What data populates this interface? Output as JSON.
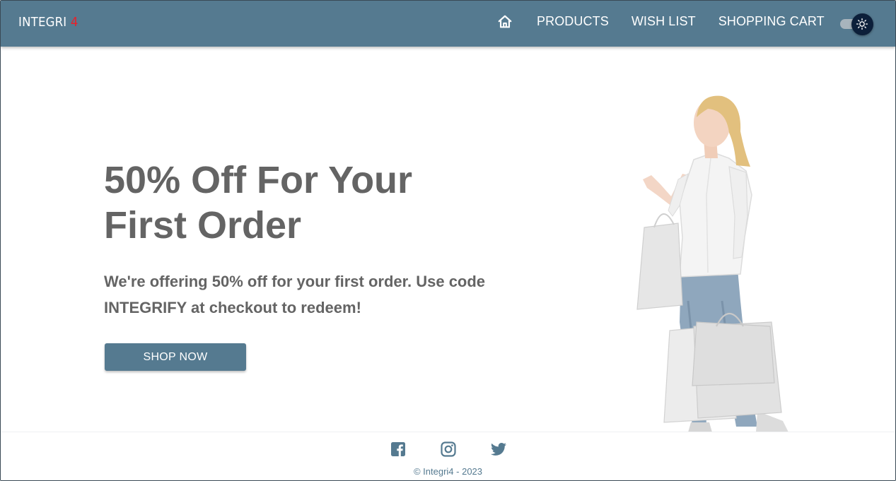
{
  "header": {
    "logo_text": "INTEGRI",
    "logo_number": "4",
    "nav": {
      "home_icon": "home-icon",
      "products": "PRODUCTS",
      "wish_list": "WISH LIST",
      "shopping_cart": "SHOPPING CART"
    },
    "theme_toggle_icon": "sun-icon"
  },
  "hero": {
    "title_line1": "50% Off For Your",
    "title_line2": "First Order",
    "text_line1": "We're offering 50% off for your first order. Use code",
    "text_line2": "INTEGRIFY at checkout to redeem!",
    "button_label": "SHOP NOW"
  },
  "footer": {
    "icons": [
      "facebook-icon",
      "instagram-icon",
      "twitter-icon"
    ],
    "copyright": "© Integri4 - 2023"
  },
  "colors": {
    "primary": "#557a90",
    "logo_accent": "#e8202a",
    "heading_text": "#646464",
    "toggle_thumb": "#0c1f3a"
  }
}
